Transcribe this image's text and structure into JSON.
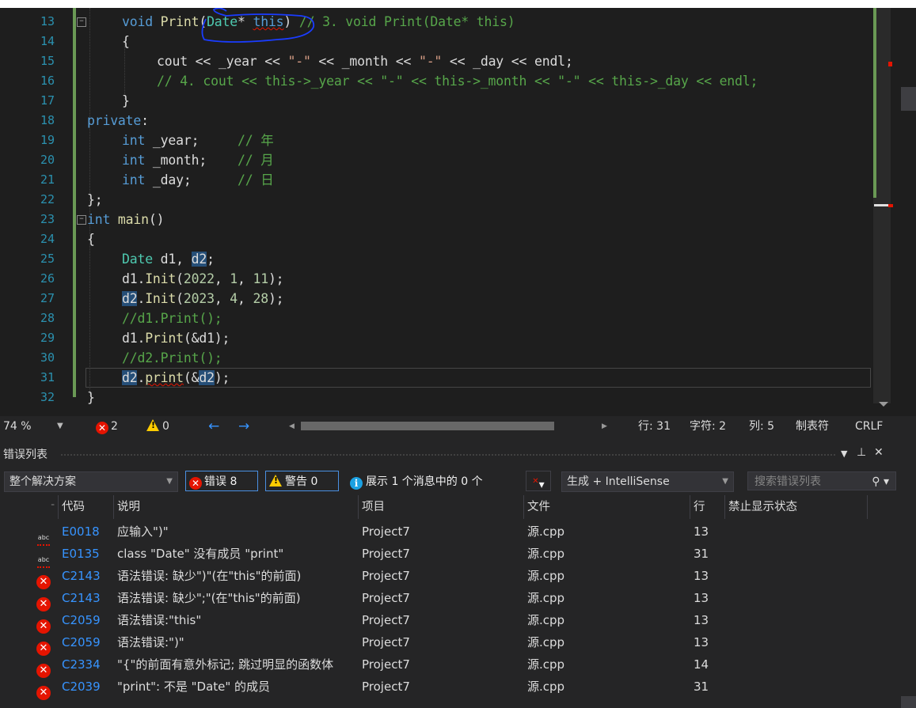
{
  "editor": {
    "lines": [
      {
        "n": "13"
      },
      {
        "n": "14"
      },
      {
        "n": "15"
      },
      {
        "n": "16"
      },
      {
        "n": "17"
      },
      {
        "n": "18"
      },
      {
        "n": "19"
      },
      {
        "n": "20"
      },
      {
        "n": "21"
      },
      {
        "n": "22"
      },
      {
        "n": "23"
      },
      {
        "n": "24"
      },
      {
        "n": "25"
      },
      {
        "n": "26"
      },
      {
        "n": "27"
      },
      {
        "n": "28"
      },
      {
        "n": "29"
      },
      {
        "n": "30"
      },
      {
        "n": "31"
      },
      {
        "n": "32"
      }
    ],
    "code": {
      "l13_kw": "void",
      "l13_fn": " Print",
      "l13_a": "(",
      "l13_ty": "Date",
      "l13_b": "* ",
      "l13_this": "this",
      "l13_c": ")",
      "l13_cm": " // 3. void Print(Date* this)",
      "l14": "{",
      "l15_a": "cout << ",
      "l15_b": "_year",
      "l15_c": " << ",
      "l15_d": "\"-\"",
      "l15_e": " << ",
      "l15_f": "_month",
      "l15_g": " << ",
      "l15_h": "\"-\"",
      "l15_i": " << ",
      "l15_j": "_day",
      "l15_k": " << endl;",
      "l16_cm": "// 4. cout << this->_year << \"-\" << this->_month << \"-\" << this->_day << endl;",
      "l17": "}",
      "l18_kw": "private",
      "l18_b": ":",
      "l19_kw": "int",
      "l19_v": " _year;",
      "l19_cm": "     // 年",
      "l20_kw": "int",
      "l20_v": " _month;",
      "l20_cm": "    // 月",
      "l21_kw": "int",
      "l21_v": " _day;",
      "l21_cm": "      // 日",
      "l22": "};",
      "l23_kw": "int",
      "l23_fn": " main",
      "l23_b": "()",
      "l24": "{",
      "l25_ty": "Date",
      "l25_a": " d1, ",
      "l25_d2": "d2",
      "l25_b": ";",
      "l26_a": "d1.",
      "l26_fn": "Init",
      "l26_b": "(",
      "l26_n1": "2022",
      "l26_c": ", ",
      "l26_n2": "1",
      "l26_d": ", ",
      "l26_n3": "11",
      "l26_e": ");",
      "l27_d2": "d2",
      "l27_a": ".",
      "l27_fn": "Init",
      "l27_b": "(",
      "l27_n1": "2023",
      "l27_c": ", ",
      "l27_n2": "4",
      "l27_d": ", ",
      "l27_n3": "28",
      "l27_e": ");",
      "l28_cm": "//d1.Print();",
      "l29_a": "d1.",
      "l29_fn": "Print",
      "l29_b": "(&d1);",
      "l30_cm": "//d2.Print();",
      "l31_d2": "d2",
      "l31_a": ".",
      "l31_fn": "print",
      "l31_b": "(&",
      "l31_d2b": "d2",
      "l31_c": ");",
      "l32": "}"
    }
  },
  "statusbar": {
    "zoom": "74 %",
    "errors": "2",
    "warnings": "0",
    "row": "行: 31",
    "char": "字符: 2",
    "col": "列: 5",
    "tabs": "制表符",
    "eol": "CRLF"
  },
  "panel": {
    "title": "错误列表",
    "pin": "▾  ⨆",
    "close": "✕",
    "scope": "整个解决方案",
    "errors_btn": "错误 8",
    "warnings_btn": "警告 0",
    "messages_btn": "展示 1 个消息中的 0 个",
    "build_filter": "生成 + IntelliSense",
    "search_placeholder": "搜索错误列表",
    "columns": {
      "code": "代码",
      "description": "说明",
      "project": "项目",
      "file": "文件",
      "line": "行",
      "suppression": "禁止显示状态"
    },
    "rows": [
      {
        "kind": "intellisense",
        "code": "E0018",
        "desc": "应输入\")\"",
        "project": "Project7",
        "file": "源.cpp",
        "line": "13"
      },
      {
        "kind": "intellisense",
        "code": "E0135",
        "desc": "class \"Date\" 没有成员 \"print\"",
        "project": "Project7",
        "file": "源.cpp",
        "line": "31"
      },
      {
        "kind": "error",
        "code": "C2143",
        "desc": "语法错误: 缺少\")\"(在\"this\"的前面)",
        "project": "Project7",
        "file": "源.cpp",
        "line": "13"
      },
      {
        "kind": "error",
        "code": "C2143",
        "desc": "语法错误: 缺少\";\"(在\"this\"的前面)",
        "project": "Project7",
        "file": "源.cpp",
        "line": "13"
      },
      {
        "kind": "error",
        "code": "C2059",
        "desc": "语法错误:\"this\"",
        "project": "Project7",
        "file": "源.cpp",
        "line": "13"
      },
      {
        "kind": "error",
        "code": "C2059",
        "desc": "语法错误:\")\"",
        "project": "Project7",
        "file": "源.cpp",
        "line": "13"
      },
      {
        "kind": "error",
        "code": "C2334",
        "desc": "\"{\"的前面有意外标记; 跳过明显的函数体",
        "project": "Project7",
        "file": "源.cpp",
        "line": "14"
      },
      {
        "kind": "error",
        "code": "C2039",
        "desc": "\"print\": 不是 \"Date\" 的成员",
        "project": "Project7",
        "file": "源.cpp",
        "line": "31"
      }
    ]
  },
  "icons": {
    "error": "error-icon",
    "warning": "warning-icon",
    "info": "info-icon",
    "spell": "abc-spell-icon",
    "filter": "filter-icon",
    "search": "search-icon"
  },
  "colors": {
    "error": "#e51400",
    "warning": "#ffcc00",
    "info": "#1ba1e2",
    "link": "#3794ff",
    "keyword": "#569cd6",
    "type": "#4ec9b0",
    "function": "#dcdcaa",
    "comment": "#57a64a",
    "string": "#d69d85",
    "number": "#b5cea8"
  }
}
